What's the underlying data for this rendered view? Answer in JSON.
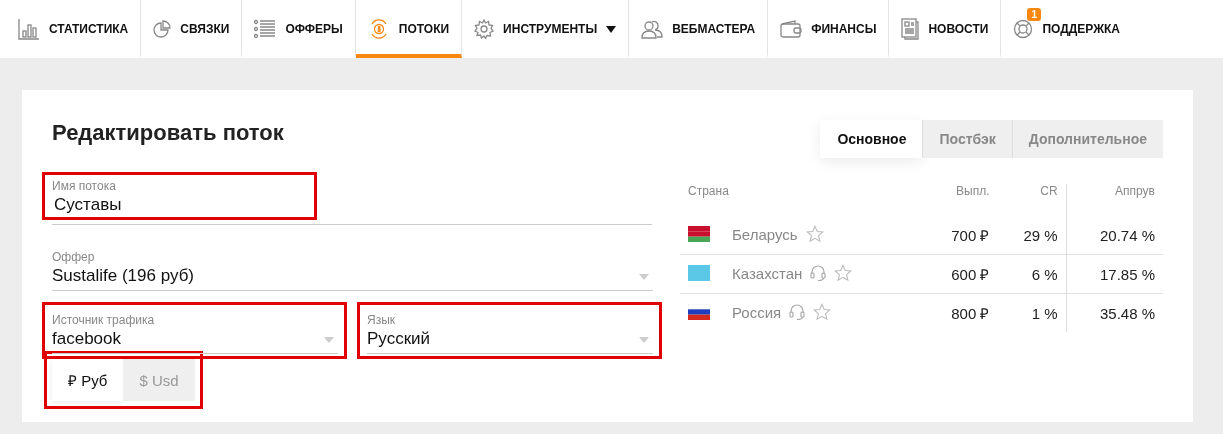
{
  "nav": [
    {
      "label": "СТАТИСТИКА",
      "selected": false
    },
    {
      "label": "СВЯЗКИ",
      "selected": false
    },
    {
      "label": "ОФФЕРЫ",
      "selected": false
    },
    {
      "label": "ПОТОКИ",
      "selected": true
    },
    {
      "label": "ИНСТРУМЕНТЫ",
      "selected": false,
      "dropdown": true
    },
    {
      "label": "ВЕБМАСТЕРА",
      "selected": false
    },
    {
      "label": "ФИНАНСЫ",
      "selected": false
    },
    {
      "label": "НОВОСТИ",
      "selected": false
    },
    {
      "label": "ПОДДЕРЖКА",
      "selected": false,
      "badge": "1"
    }
  ],
  "title": "Редактировать поток",
  "fields": [
    {
      "label": "Имя потока",
      "value": "Суставы",
      "kind": "text",
      "highlighted": true
    },
    {
      "label": "Оффер",
      "value": "Sustalife (196 руб)",
      "kind": "select",
      "highlighted": false
    },
    {
      "label": "Источник трафика",
      "value": "facebook",
      "kind": "select",
      "highlighted": true
    },
    {
      "label": "Язык",
      "value": "Русский",
      "kind": "select",
      "highlighted": true
    }
  ],
  "currency": {
    "highlighted": true,
    "options": [
      {
        "label": "₽ Руб",
        "selected": true
      },
      {
        "label": "$ Usd",
        "selected": false
      }
    ]
  },
  "tabs": [
    {
      "label": "Основное",
      "selected": true
    },
    {
      "label": "Постбэк",
      "selected": false
    },
    {
      "label": "Дополнительное",
      "selected": false
    }
  ],
  "table": {
    "columns": [
      "Страна",
      "Выпл.",
      "CR",
      "Аппрув"
    ],
    "rows": [
      {
        "country": "Беларусь",
        "support": false,
        "payout": "700 ₽",
        "cr": "29 %",
        "approve": "20.74 %"
      },
      {
        "country": "Казахстан",
        "support": true,
        "payout": "600 ₽",
        "cr": "6 %",
        "approve": "17.85 %"
      },
      {
        "country": "Россия",
        "support": true,
        "payout": "800 ₽",
        "cr": "1 %",
        "approve": "35.48 %"
      }
    ]
  }
}
